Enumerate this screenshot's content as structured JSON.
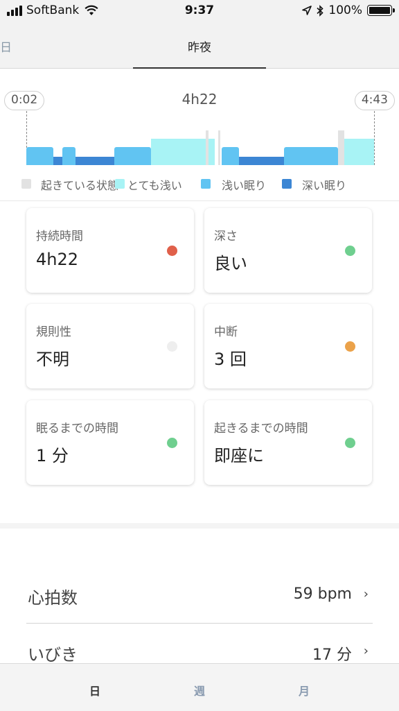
{
  "status_bar": {
    "carrier": "SoftBank",
    "time": "9:37",
    "battery": "100%"
  },
  "top_tabs": {
    "prev_label": "日",
    "active_label": "昨夜"
  },
  "chart": {
    "start_time": "0:02",
    "end_time": "4:43",
    "duration": "4h22",
    "legend": [
      "起きている状態",
      "とても浅い",
      "浅い眠り",
      "深い眠り"
    ]
  },
  "chart_data": {
    "type": "bar",
    "title": "4h22",
    "x_start": "0:02",
    "x_end": "4:43",
    "stages": [
      "起きている状態",
      "とても浅い",
      "浅い眠り",
      "深い眠り"
    ],
    "colors": {
      "起きている状態": "#e2e2e2",
      "とても浅い": "#a8f3f5",
      "浅い眠り": "#61c4f2",
      "深い眠り": "#3c86d4"
    },
    "segments_minutes": [
      {
        "stage": "浅い眠り",
        "start": 0,
        "end": 22
      },
      {
        "stage": "深い眠り",
        "start": 22,
        "end": 29
      },
      {
        "stage": "浅い眠り",
        "start": 29,
        "end": 40
      },
      {
        "stage": "深い眠り",
        "start": 40,
        "end": 71
      },
      {
        "stage": "浅い眠り",
        "start": 71,
        "end": 101
      },
      {
        "stage": "とても浅い",
        "start": 101,
        "end": 145
      },
      {
        "stage": "起きている状態",
        "start": 145,
        "end": 147
      },
      {
        "stage": "とても浅い",
        "start": 147,
        "end": 152
      },
      {
        "stage": "起きている状態",
        "start": 155,
        "end": 157
      },
      {
        "stage": "浅い眠り",
        "start": 158,
        "end": 172
      },
      {
        "stage": "深い眠り",
        "start": 172,
        "end": 208
      },
      {
        "stage": "浅い眠り",
        "start": 208,
        "end": 252
      },
      {
        "stage": "起きている状態",
        "start": 252,
        "end": 257
      },
      {
        "stage": "とても浅い",
        "start": 257,
        "end": 281
      }
    ]
  },
  "cards": [
    {
      "title": "持続時間",
      "value": "4h22",
      "dot_color": "#e0604a"
    },
    {
      "title": "深さ",
      "value": "良い",
      "dot_color": "#6fcf8f"
    },
    {
      "title": "規則性",
      "value": "不明",
      "dot_color": "#eeeeee"
    },
    {
      "title": "中断",
      "value": "3 回",
      "dot_color": "#eba24a"
    },
    {
      "title": "眠るまでの時間",
      "value": "1 分",
      "dot_color": "#6fcf8f"
    },
    {
      "title": "起きるまでの時間",
      "value": "即座に",
      "dot_color": "#6fcf8f"
    }
  ],
  "details": [
    {
      "label": "心拍数",
      "value": "59 bpm"
    },
    {
      "label": "いびき",
      "value": "17 分"
    }
  ],
  "bottom_tabs": [
    {
      "label": "日",
      "color": "#333333"
    },
    {
      "label": "週",
      "color": "#8a9bb0"
    },
    {
      "label": "月",
      "color": "#8a9bb0"
    }
  ]
}
